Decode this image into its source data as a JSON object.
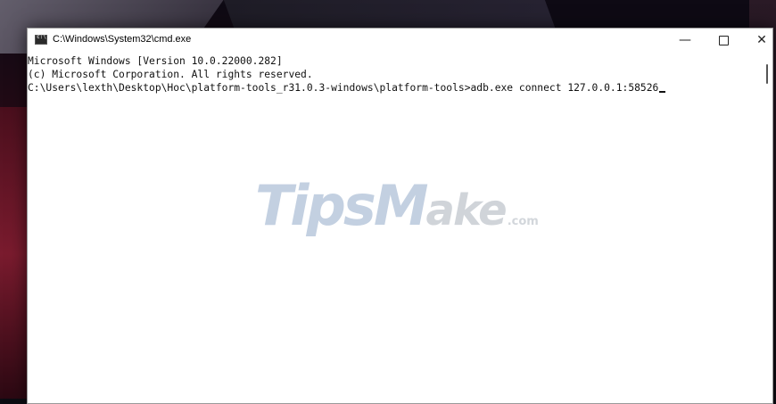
{
  "window": {
    "title": "C:\\Windows\\System32\\cmd.exe",
    "controls": {
      "minimize": "—",
      "close": "✕"
    }
  },
  "console": {
    "lines": [
      "Microsoft Windows [Version 10.0.22000.282]",
      "(c) Microsoft Corporation. All rights reserved.",
      "",
      "C:\\Users\\lexth\\Desktop\\Hoc\\platform-tools_r31.0.3-windows\\platform-tools>adb.exe connect 127.0.0.1:58526"
    ]
  },
  "watermark": {
    "t": "T",
    "ips": "ips",
    "m": "M",
    "ake": "ake",
    "com": ".com"
  },
  "icons": {
    "app": "cmd-icon",
    "minimize": "minimize-icon",
    "maximize": "maximize-icon",
    "close": "close-icon"
  }
}
